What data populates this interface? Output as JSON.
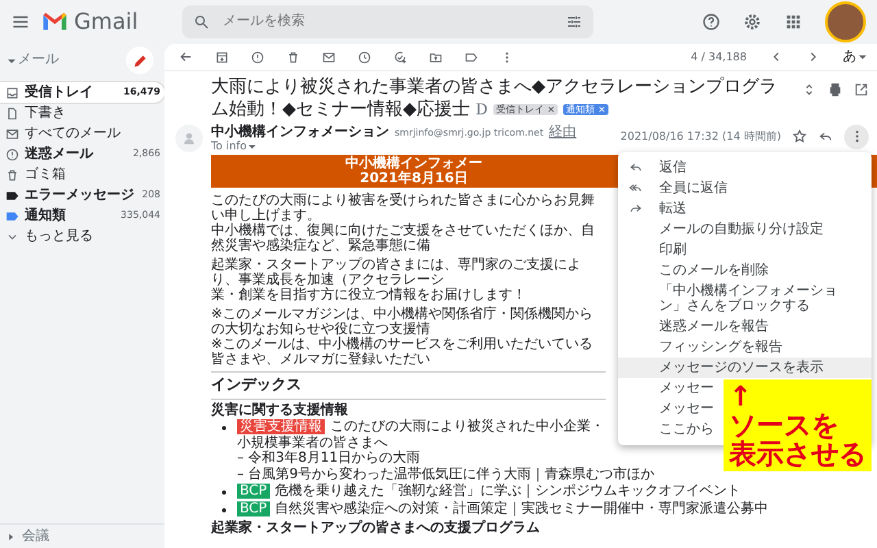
{
  "header": {
    "app_name": "Gmail",
    "search": {
      "placeholder": "メールを検索"
    }
  },
  "sidebar": {
    "section": "メール",
    "items": [
      {
        "kind": "inbox",
        "label": "受信トレイ",
        "count": "16,479",
        "selected": true,
        "unread": true
      },
      {
        "kind": "drafts",
        "label": "下書き",
        "selected": false,
        "unread": false
      },
      {
        "kind": "all",
        "label": "すべてのメール",
        "selected": false,
        "unread": false
      },
      {
        "kind": "spam",
        "label": "迷惑メール",
        "count": "2,866",
        "selected": false,
        "unread": true
      },
      {
        "kind": "trash",
        "label": "ゴミ箱",
        "selected": false,
        "unread": false
      },
      {
        "kind": "label",
        "label": "エラーメッセージ",
        "count": "208",
        "color": "#202124",
        "selected": false,
        "unread": true
      },
      {
        "kind": "label",
        "label": "通知類",
        "count": "335,044",
        "color": "#4285f4",
        "selected": false,
        "unread": true
      },
      {
        "kind": "more",
        "label": "もっと見る",
        "selected": false,
        "unread": false
      }
    ],
    "footer": "会議"
  },
  "toolbar": {
    "counter": "4 / 34,188",
    "input_mode": "あ"
  },
  "email": {
    "subject": "大雨により被災された事業者の皆さまへ◆アクセラレーションプログラム始動！◆セミナー情報◆応援士",
    "marker": "D",
    "labels": [
      {
        "text": "受信トレイ",
        "remove": "×",
        "color": "#dadce0"
      },
      {
        "text": "通知類",
        "remove": "×",
        "color": "#4a86e8"
      }
    ],
    "sender": {
      "name": "中小機構インフォメーション",
      "address": "smrjinfo@smrj.go.jp",
      "via_domain": "tricom.net",
      "via_link": "経由",
      "to": "To info",
      "date": "2021/08/16 17:32 (14 時間前)"
    },
    "banner": [
      "中小機構インフォメー",
      "2021年8月16日"
    ],
    "paragraphs": [
      [
        "このたびの大雨により被害を受けられた皆さまに心からお見舞い申し上げます。",
        "中小機構では、復興に向けたご支援をさせていただくほか、自然災害や感染症など、緊急事態に備"
      ],
      [
        "起業家・スタートアップの皆さまには、専門家のご支援により、事業成長を加速（アクセラレーシ",
        "業・創業を目指す方に役立つ情報をお届けします！"
      ],
      [
        "※このメールマガジンは、中小機構や関係省庁・関係機関からの大切なお知らせや役に立つ支援情",
        "※このメールは、中小機構のサービスをご利用いただいている皆さまや、メルマガに登録いただい"
      ]
    ],
    "index_heading": "インデックス",
    "sections": [
      {
        "heading": "災害に関する支援情報",
        "items": [
          {
            "tag": "災害支援情報",
            "color": "#e8453c",
            "text": "このたびの大雨により被災された中小企業・小規模事業者の皆さまへ",
            "children": [
              {
                "text": "– 令和3年8月11日からの大雨"
              },
              {
                "text": "– 台風第9号から変わった温帯低気圧に伴う大雨｜青森県むつ市ほか"
              }
            ]
          },
          {
            "tag": "BCP",
            "color": "#16a765",
            "text": "危機を乗り越えた「強靭な経営」に学ぶ｜シンポジウムキックオフイベント"
          },
          {
            "tag": "BCP",
            "color": "#16a765",
            "text": "自然災害や感染症への対策・計画策定｜実践セミナー開催中・専門家派遣公募中"
          }
        ]
      },
      {
        "heading": "起業家・スタートアップの皆さまへの支援プログラム"
      }
    ]
  },
  "menu": [
    {
      "kind": "reply",
      "label": "返信",
      "hovered": false
    },
    {
      "kind": "reply_all",
      "label": "全員に返信",
      "hovered": false
    },
    {
      "kind": "forward",
      "label": "転送",
      "hovered": false
    },
    {
      "kind": "plain",
      "label": "メールの自動振り分け設定",
      "hovered": false
    },
    {
      "kind": "plain",
      "label": "印刷",
      "hovered": false
    },
    {
      "kind": "plain",
      "label": "このメールを削除",
      "hovered": false
    },
    {
      "kind": "plain",
      "label": "「中小機構インフォメーション」さんをブロックする",
      "hovered": false
    },
    {
      "kind": "plain",
      "label": "迷惑メールを報告",
      "hovered": false
    },
    {
      "kind": "plain",
      "label": "フィッシングを報告",
      "hovered": false
    },
    {
      "kind": "plain",
      "label": "メッセージのソースを表示",
      "hovered": true
    },
    {
      "kind": "plain",
      "label": "メッセー",
      "hovered": false
    },
    {
      "kind": "plain",
      "label": "メッセー",
      "hovered": false
    },
    {
      "kind": "plain",
      "label": "ここから",
      "hovered": false
    }
  ],
  "callout": {
    "arrow": "↑",
    "lines": [
      "ソースを",
      "表示させる"
    ]
  }
}
